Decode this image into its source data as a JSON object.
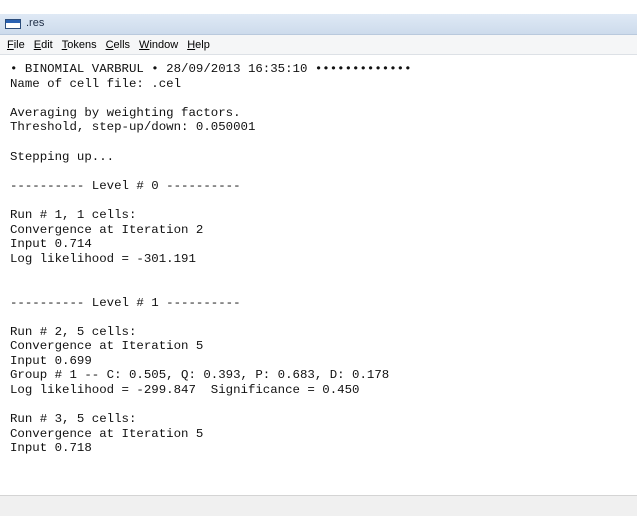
{
  "window": {
    "title": ".res",
    "icon": "document-window-icon"
  },
  "menu": [
    {
      "access_key": "F",
      "rest": "ile"
    },
    {
      "access_key": "E",
      "rest": "dit"
    },
    {
      "access_key": "T",
      "rest": "okens"
    },
    {
      "access_key": "C",
      "rest": "ells"
    },
    {
      "access_key": "W",
      "rest": "indow"
    },
    {
      "access_key": "H",
      "rest": "elp"
    }
  ],
  "output_lines": [
    "• BINOMIAL VARBRUL • 28/09/2013 16:35:10 •••••••••••••",
    "Name of cell file: .cel",
    "",
    "Averaging by weighting factors.",
    "Threshold, step-up/down: 0.050001",
    "",
    "Stepping up...",
    "",
    "---------- Level # 0 ----------",
    "",
    "Run # 1, 1 cells:",
    "Convergence at Iteration 2",
    "Input 0.714",
    "Log likelihood = -301.191",
    "",
    "",
    "---------- Level # 1 ----------",
    "",
    "Run # 2, 5 cells:",
    "Convergence at Iteration 5",
    "Input 0.699",
    "Group # 1 -- C: 0.505, Q: 0.393, P: 0.683, D: 0.178",
    "Log likelihood = -299.847  Significance = 0.450",
    "",
    "Run # 3, 5 cells:",
    "Convergence at Iteration 5",
    "Input 0.718"
  ]
}
